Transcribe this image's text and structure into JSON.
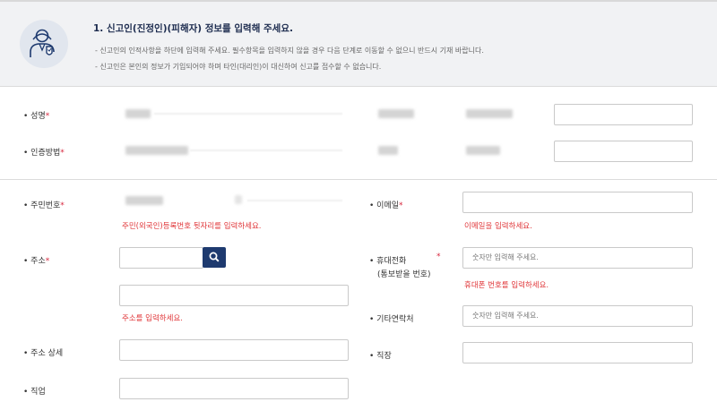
{
  "section": {
    "title": "1. 신고인(진정인)(피해자) 정보를 입력해 주세요.",
    "notes": [
      "-  신고인의 인적사항을 하단에 입력해 주세요. 필수항목을 입력하지 않을 경우 다음 단계로 이동할 수 없으니 반드시 기재 바랍니다.",
      "-  신고인은 본인의 정보가 기입되어야 하며 타인(대리인)이 대신하여 신고를 접수할 수 없습니다."
    ]
  },
  "fields": {
    "name": "•  성명",
    "auth_method": "•  인증방법",
    "resident_no": "•  주민번호",
    "address": "•  주소",
    "address_detail": "•  주소 상세",
    "job": "•  직업",
    "email": "•  이메일",
    "mobile_line1": "•  휴대전화",
    "mobile_line2": "(통보받을 번호)",
    "other_contact": "•  기타연락처",
    "workplace": "•  직장",
    "required_mark": "*"
  },
  "placeholders": {
    "mobile": "숫자만 입력해 주세요.",
    "other_contact": "숫자만 입력해 주세요."
  },
  "errors": {
    "resident_no": "주민(외국인)등록번호 뒷자리를 입력하세요.",
    "email": "이메일을 입력하세요.",
    "address": "주소를 입력하세요.",
    "mobile": "휴대폰 번호를 입력하세요."
  },
  "colors": {
    "accent": "#1e3a6f",
    "error": "#e0373a",
    "required": "#d7263d",
    "header_bg": "#f1f2f4"
  },
  "icons": [
    "user-shield-icon",
    "search-icon"
  ]
}
